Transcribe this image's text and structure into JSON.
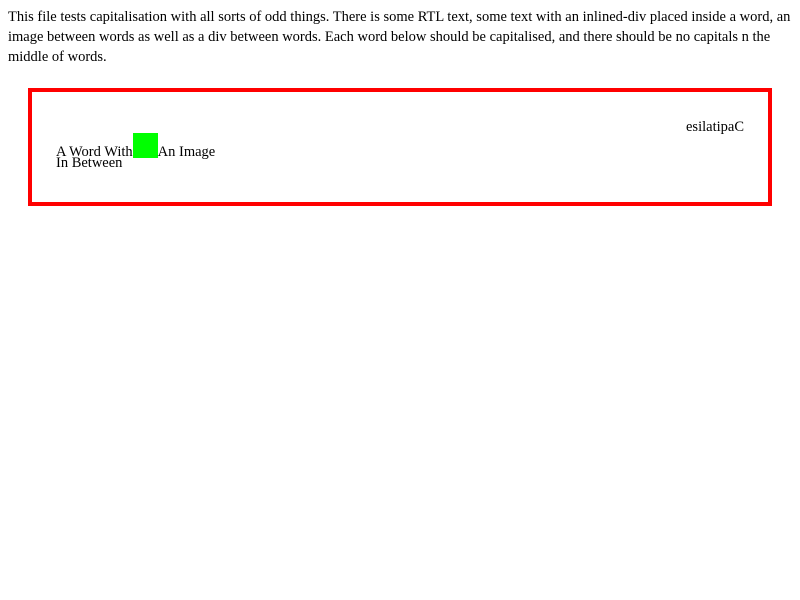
{
  "intro": {
    "text": "This file tests capitalisation with all sorts of odd things. There is some RTL text, some text with an inlined-div placed inside a word, an image between words as well as a div between words. Each word below should be capitalised, and there should be no capitals n the middle of words."
  },
  "test_box": {
    "rtl_text": "esilatipaC",
    "line1_before_image": "A Word With",
    "line1_after_image": "An Image",
    "line2": "In Between",
    "image_color": "#00ff00",
    "border_color": "#ff0000"
  }
}
